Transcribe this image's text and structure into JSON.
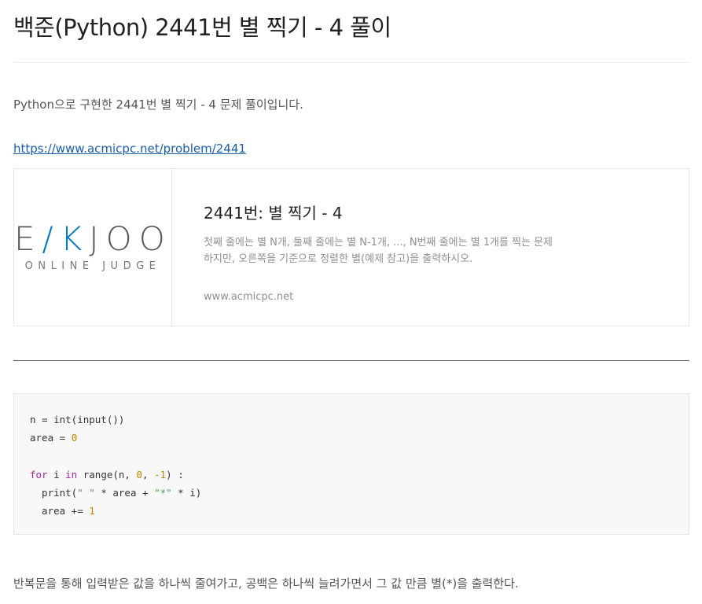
{
  "post": {
    "title": "백준(Python) 2441번 별 찍기 - 4 풀이",
    "intro": "Python으로 구현한 2441번 별 찍기 - 4 문제 풀이입니다.",
    "link_text": "https://www.acmicpc.net/problem/2441",
    "outro": "반복문을 통해 입력받은 값을 하나씩 줄여가고, 공백은 하나씩 늘려가면서 그 값 만큼 별(*)을 출력한다."
  },
  "link_card": {
    "logo_main_left": "E",
    "logo_main_k": "/K",
    "logo_main_right": "JOO",
    "logo_sub": "ONLINE JUDGE",
    "title": "2441번: 별 찍기 - 4",
    "description_line1": "첫째 줄에는 별 N개, 둘째 줄에는 별 N-1개, ..., N번째 줄에는 별 1개를 찍는 문제",
    "description_line2": "하지만, 오른쪽을 기준으로 정렬한 별(예제 참고)을 출력하시오.",
    "domain": "www.acmicpc.net"
  },
  "code": {
    "line1": "n = int(input())",
    "line2_a": "area = ",
    "line2_num": "0",
    "line4_for": "for",
    "line4_mid": " i ",
    "line4_in": "in",
    "line4_call": " range(n, ",
    "line4_n0": "0",
    "line4_sep": ", ",
    "line4_n1": "-1",
    "line4_end": ") :",
    "line5_a": "  print(",
    "line5_s1": "\" \"",
    "line5_b": " * area + ",
    "line5_s2": "\"*\"",
    "line5_c": " * i)",
    "line6_a": "  area += ",
    "line6_num": "1"
  },
  "colors": {
    "keyword": "#a626a4",
    "number": "#c18401",
    "string": "#50a14f",
    "link": "#1a5dab",
    "logo_accent": "#0076c0"
  }
}
